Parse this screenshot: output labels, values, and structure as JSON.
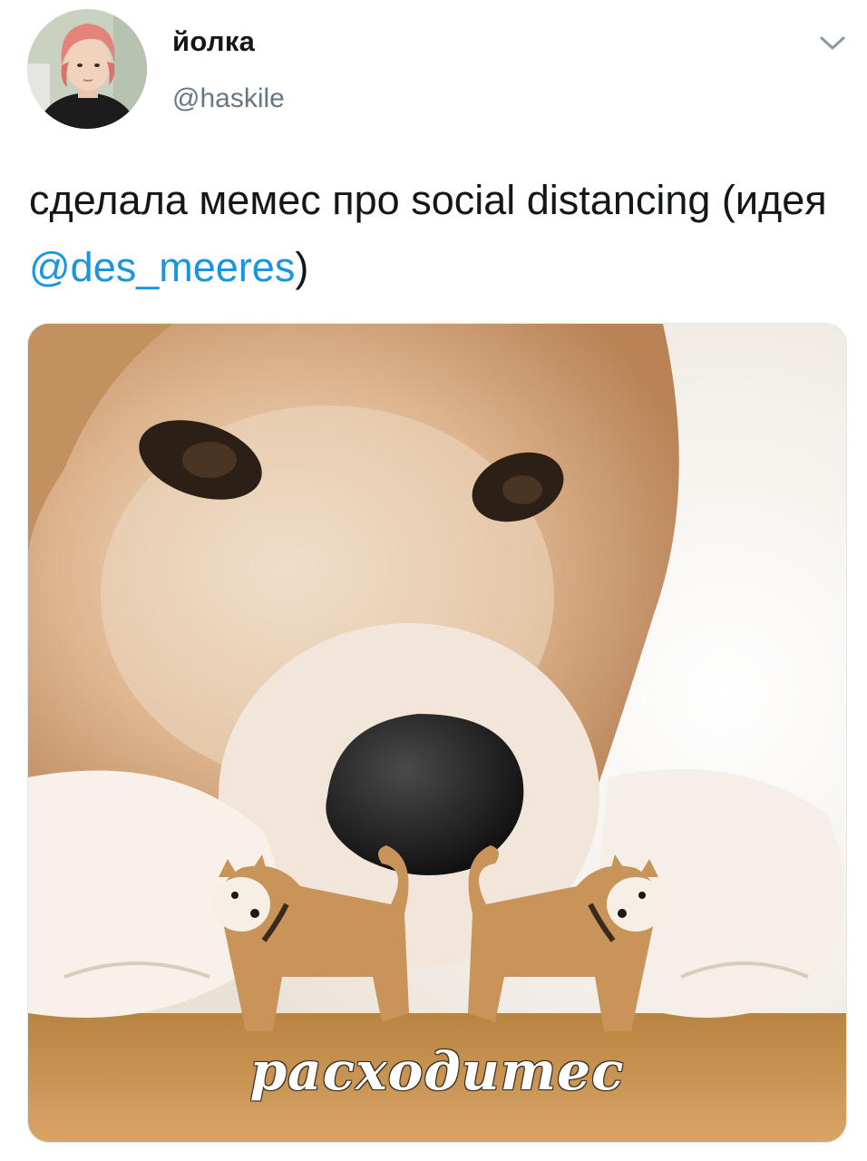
{
  "tweet": {
    "author": {
      "display_name": "йолка",
      "handle": "@haskile",
      "avatar_icon": "user-avatar-photo"
    },
    "menu_icon": "chevron-down-icon",
    "text_before_mention": "сделала мемес про social distancing (идея ",
    "mention": "@des_meeres",
    "text_after_mention": ")",
    "media": {
      "caption": "расходитес"
    }
  },
  "colors": {
    "text": "#14171a",
    "secondary": "#657786",
    "link": "#1b95e0",
    "border": "#e1e8ed"
  }
}
